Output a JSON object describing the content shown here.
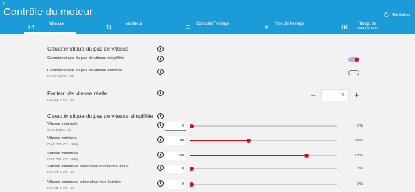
{
  "header": {
    "back_symbol": "‹",
    "title": "Contrôle du moteur",
    "reset_label": "Réinitialiser"
  },
  "tabs": [
    {
      "label": "Vitesse",
      "icon": "gauge-icon",
      "active": true
    },
    {
      "label": "Variateur",
      "icon": "sort-arrows-icon",
      "active": false
    },
    {
      "label": "Conduite/Freinage",
      "icon": "list-lines-icon",
      "active": false
    },
    {
      "label": "Voie de freinage",
      "icon": "track-segment-icon",
      "active": false
    },
    {
      "label": "Tango de manœuvre",
      "icon": "pinball-icon",
      "active": false
    }
  ],
  "speed_step": {
    "heading": "Caractéristique du pas de vitesse",
    "simplified_label": "Caractéristique du pas de vitesse simplifiée",
    "simplified_on": true,
    "extended_label": "Caractéristique du pas de vitesse étendue",
    "extended_cv": "CV 29: 6 (CV = 14)",
    "extended_on": false
  },
  "real_speed": {
    "heading": "Facteur de vitesse réelle",
    "cv": "CV 252: 0 (CV = 0)",
    "value": "0",
    "minus_symbol": "−",
    "plus_symbol": "+"
  },
  "simplified": {
    "heading": "Caractéristique du pas de vitesse simplifiée",
    "rows": [
      {
        "label": "Vitesse minimale",
        "cv": "CV 2: 0 (CV = 0)",
        "value": "0",
        "percent_label": "0 %",
        "percent": 0
      },
      {
        "label": "Vitesse médiane",
        "cv": "CV 6: 100 (CV = 100)",
        "value": "100",
        "percent_label": "39 %",
        "percent": 39
      },
      {
        "label": "Vitesse maximale",
        "cv": "CV 5: 200 (CV = 200)",
        "value": "200",
        "percent_label": "78 %",
        "percent": 78
      },
      {
        "label": "Vitesse maximale alternative en marche avant",
        "cv": "CV 147: 0 (CV = 0)",
        "value": "0",
        "percent_label": "0 %",
        "percent": 0
      },
      {
        "label": "Vitesse maximale alternative vers l'arrière",
        "cv": "CV 148: 0 (CV = 0)",
        "value": "0",
        "percent_label": "0 %",
        "percent": 0
      }
    ]
  },
  "info_symbol": "i",
  "colors": {
    "header": "#1b9bd8",
    "accent": "#d0101e",
    "toggle_track": "#c9a9e3"
  }
}
